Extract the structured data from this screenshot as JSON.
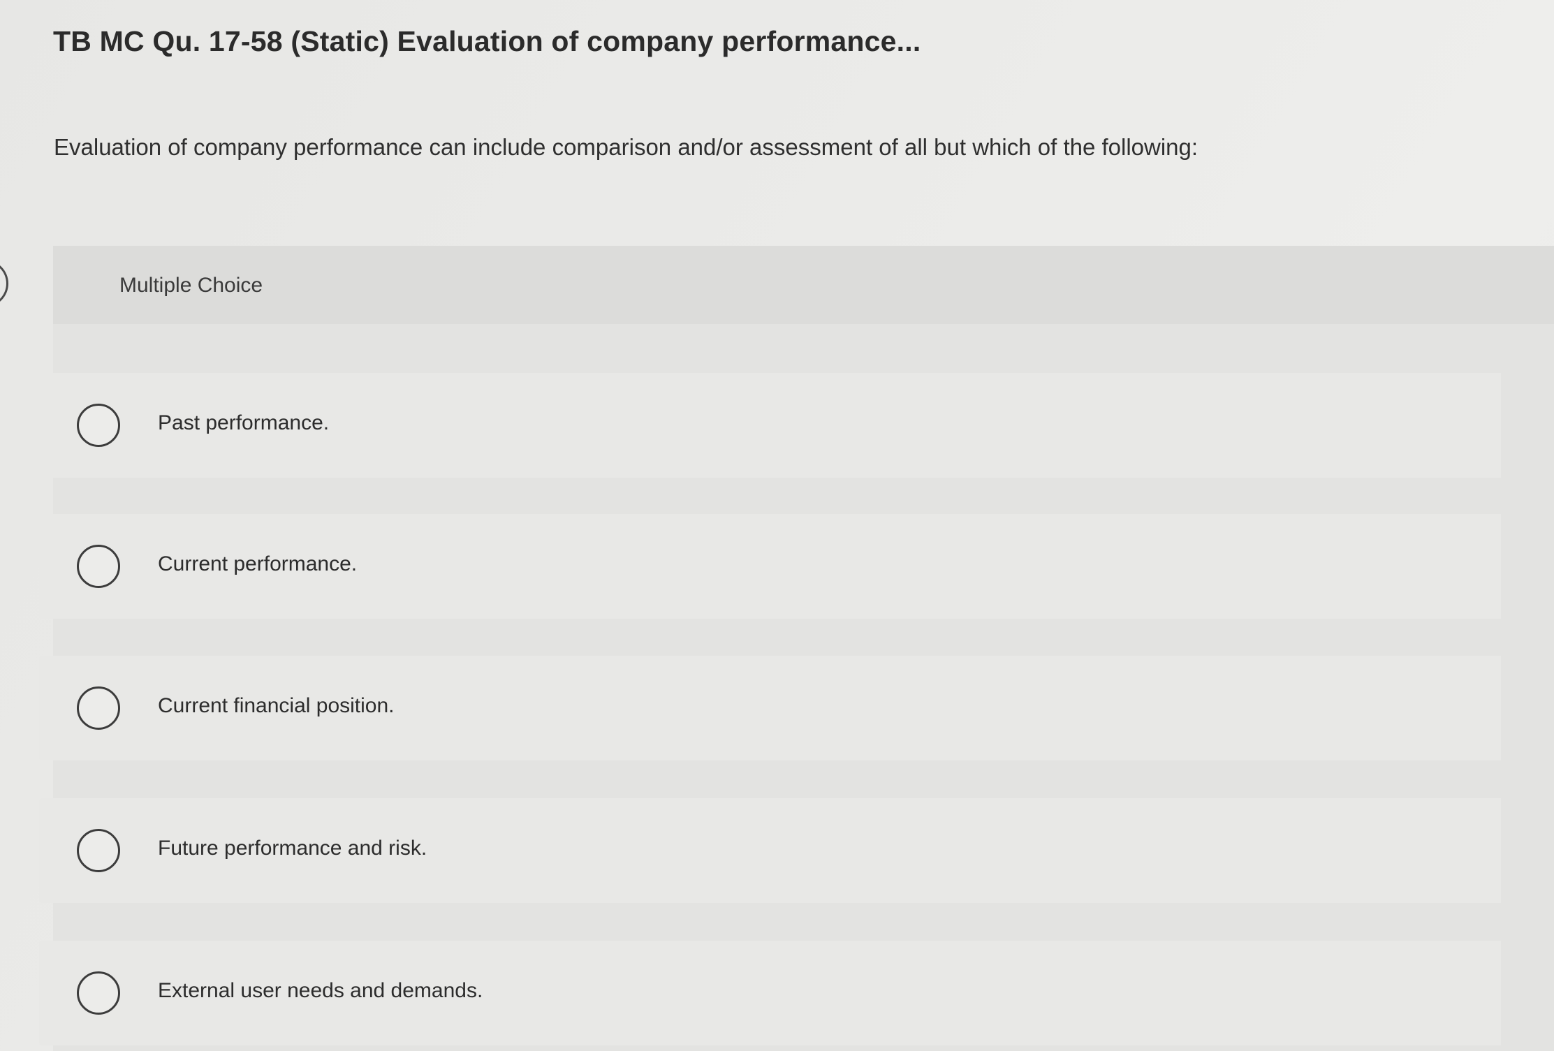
{
  "question": {
    "title": "TB MC Qu. 17-58 (Static) Evaluation of company performance...",
    "prompt": "Evaluation of company performance can include comparison and/or assessment of all but which of the following:"
  },
  "choices": {
    "header": "Multiple Choice",
    "options": [
      {
        "label": "Past performance.",
        "selected": false
      },
      {
        "label": "Current performance.",
        "selected": false
      },
      {
        "label": "Current financial position.",
        "selected": false
      },
      {
        "label": "Future performance and risk.",
        "selected": false
      },
      {
        "label": "External user needs and demands.",
        "selected": false
      }
    ]
  }
}
